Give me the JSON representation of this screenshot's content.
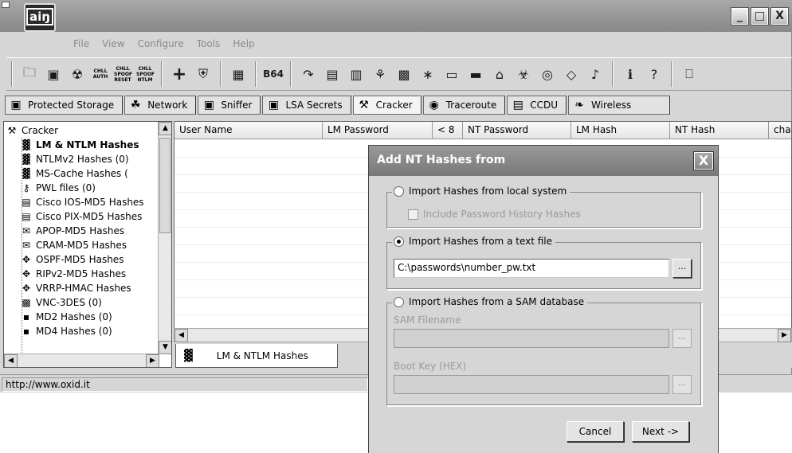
{
  "window": {
    "app_name": "aiŋ",
    "controls": {
      "minimize": "_",
      "maximize": "□",
      "close": "X"
    }
  },
  "menu": [
    "File",
    "View",
    "Configure",
    "Tools",
    "Help"
  ],
  "toolbar": {
    "icons": [
      "folder-icon",
      "network-card-icon",
      "radiation-icon",
      "auth-icon",
      "spoof-reset-icon",
      "spoof-ntlm-icon",
      "plus-icon",
      "shield-icon",
      "grid-icon",
      "base64-icon",
      "route-icon",
      "hash-icon",
      "hash2-icon",
      "router-icon",
      "vnc-icon",
      "password-icon",
      "card-icon",
      "disk-icon",
      "cisco-icon",
      "biohazard-icon",
      "compact-disc-icon",
      "wireless-icon",
      "sound-icon",
      "info-icon",
      "help-icon",
      "lock-icon"
    ],
    "labels": {
      "challenge_auth": [
        "CHLL",
        "AUTH"
      ],
      "challenge_spoof_reset": [
        "CHLL",
        "SPOOF",
        "RESET"
      ],
      "challenge_spoof_ntlm": [
        "CHLL",
        "SPOOF",
        "NTLM"
      ],
      "base64": "B64"
    }
  },
  "tabs": [
    {
      "label": "Protected Storage",
      "icon": "storage-icon"
    },
    {
      "label": "Network",
      "icon": "network-icon"
    },
    {
      "label": "Sniffer",
      "icon": "sniffer-icon"
    },
    {
      "label": "LSA Secrets",
      "icon": "lsa-icon"
    },
    {
      "label": "Cracker",
      "icon": "cracker-icon",
      "active": true
    },
    {
      "label": "Traceroute",
      "icon": "traceroute-icon"
    },
    {
      "label": "CCDU",
      "icon": "ccdu-icon"
    },
    {
      "label": "Wireless",
      "icon": "wireless-icon"
    }
  ],
  "tree": {
    "root": "Cracker",
    "items": [
      "LM & NTLM Hashes",
      "NTLMv2 Hashes (0)",
      "MS-Cache Hashes (",
      "PWL files (0)",
      "Cisco IOS-MD5 Hashes",
      "Cisco PIX-MD5 Hashes",
      "APOP-MD5 Hashes",
      "CRAM-MD5 Hashes",
      "OSPF-MD5 Hashes",
      "RIPv2-MD5 Hashes",
      "VRRP-HMAC Hashes",
      "VNC-3DES (0)",
      "MD2 Hashes (0)",
      "MD4 Hashes (0)"
    ]
  },
  "list": {
    "columns": [
      "User Name",
      "LM Password",
      "< 8",
      "NT Password",
      "LM Hash",
      "NT Hash",
      "cha"
    ]
  },
  "bottom_tab": {
    "label": "LM & NTLM Hashes"
  },
  "status": {
    "text": "http://www.oxid.it"
  },
  "dialog": {
    "title": "Add NT Hashes from",
    "close": "X",
    "option_local": "Import Hashes from local system",
    "include_history": "Include Password History Hashes",
    "option_text_file": "Import Hashes from a text file",
    "text_file_path": "C:\\passwords\\number_pw.txt",
    "option_sam": "Import Hashes from a SAM database",
    "sam_filename_label": "SAM Filename",
    "boot_key_label": "Boot Key (HEX)",
    "browse": "...",
    "cancel": "Cancel",
    "next": "Next ->",
    "selected_option": "text_file"
  }
}
